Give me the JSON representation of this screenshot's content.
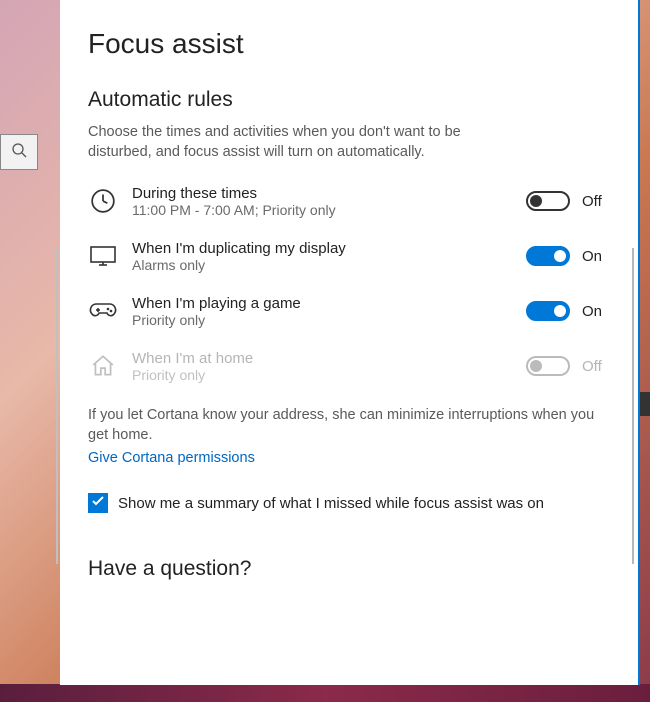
{
  "page": {
    "title": "Focus assist"
  },
  "section": {
    "title": "Automatic rules",
    "description": "Choose the times and activities when you don't want to be disturbed, and focus assist will turn on automatically."
  },
  "rules": [
    {
      "title": "During these times",
      "subtitle": "11:00 PM - 7:00 AM; Priority only",
      "state": "off",
      "state_label": "Off",
      "icon": "clock"
    },
    {
      "title": "When I'm duplicating my display",
      "subtitle": "Alarms only",
      "state": "on",
      "state_label": "On",
      "icon": "monitor"
    },
    {
      "title": "When I'm playing a game",
      "subtitle": "Priority only",
      "state": "on",
      "state_label": "On",
      "icon": "gamepad"
    },
    {
      "title": "When I'm at home",
      "subtitle": "Priority only",
      "state": "disabled",
      "state_label": "Off",
      "icon": "home"
    }
  ],
  "cortana": {
    "note": "If you let Cortana know your address, she can minimize interruptions when you get home.",
    "link": "Give Cortana permissions"
  },
  "summary_checkbox": {
    "checked": true,
    "label": "Show me a summary of what I missed while focus assist was on"
  },
  "footer": {
    "question_title": "Have a question?"
  },
  "colors": {
    "accent": "#0078d7",
    "link": "#0067c0"
  }
}
